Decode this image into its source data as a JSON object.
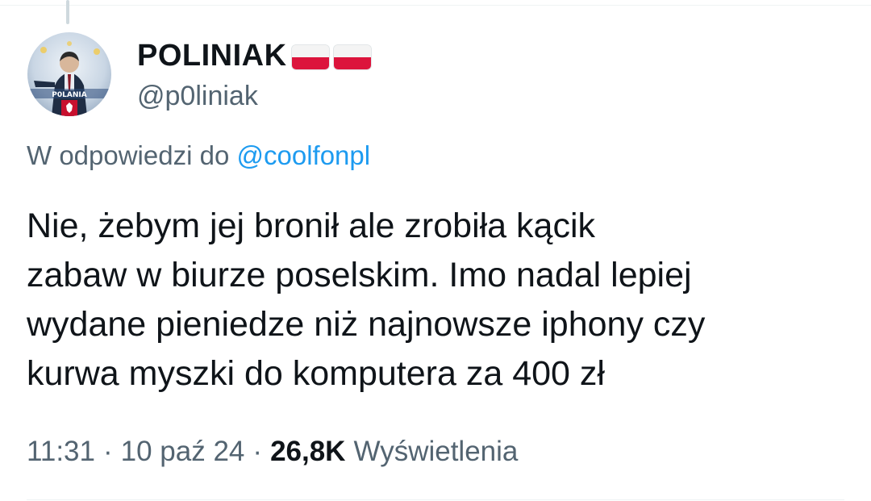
{
  "author": {
    "display_name": "POLINIAK",
    "handle": "@p0liniak",
    "flags": [
      "poland-flag",
      "poland-flag"
    ],
    "avatar_text": "P0LANIA"
  },
  "reply": {
    "prefix": "W odpowiedzi do ",
    "mention": "@coolfonpl"
  },
  "tweet": {
    "text": "Nie, żebym jej bronił ale zrobiła kącik\nzabaw w biurze poselskim. Imo nadal lepiej\nwydane pieniedze niż najnowsze iphony czy\nkurwa myszki do komputera za 400 zł"
  },
  "meta": {
    "time": "11:31",
    "date": "10 paź 24",
    "separator": "·",
    "views_count": "26,8K",
    "views_label": "Wyświetlenia"
  },
  "colors": {
    "text_primary": "#0f1419",
    "text_secondary": "#536471",
    "link": "#1d9bf0",
    "flag_red": "#dc143c"
  }
}
